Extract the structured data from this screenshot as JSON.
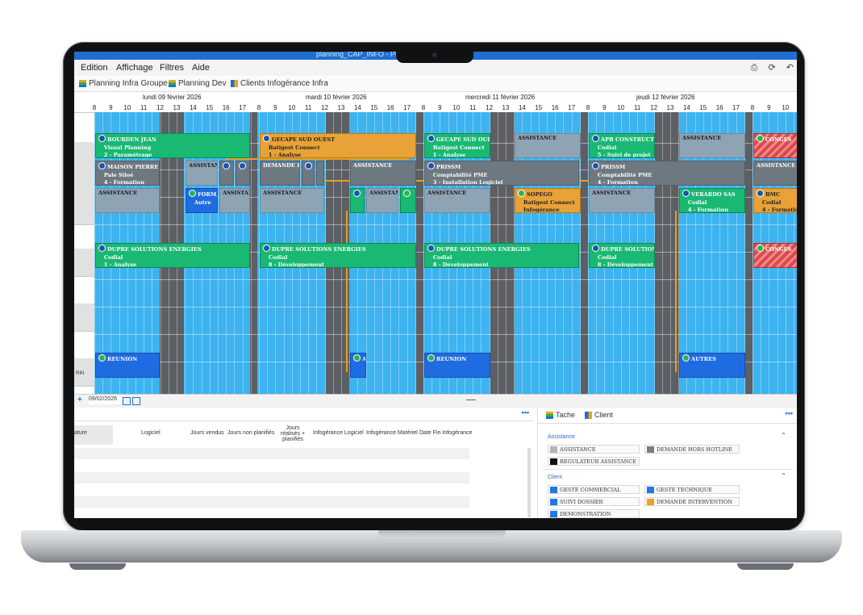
{
  "window": {
    "title": "planning_CAP_INFO - Plan"
  },
  "menu": {
    "items": [
      "Edition",
      "Affichage",
      "Filtres",
      "Aide"
    ]
  },
  "views": {
    "tabs": [
      "Planning Infra Groupe",
      "Planning Dev",
      "Clients Infogérance Infra"
    ]
  },
  "days": [
    {
      "label": "lundi 09 février 2026"
    },
    {
      "label": "mardi 10 février 2026"
    },
    {
      "label": "mercredi 11 février 2026"
    },
    {
      "label": "jeudi 12 février 2026"
    }
  ],
  "hours": [
    "8",
    "9",
    "10",
    "11",
    "12",
    "13",
    "14",
    "15",
    "16",
    "17"
  ],
  "resource_label_partial": "RIN",
  "events": {
    "e1": {
      "title": "BOURDEN JEAN",
      "l2": "Visual Planning",
      "l3": "2 - Paramétrage"
    },
    "e2": {
      "title": "GECAPE SUD OUEST",
      "l2": "Batigest Connect",
      "l3": "1 - Analyse"
    },
    "e3": {
      "title": "GECAPE SUD OUEST",
      "l2": "Batigest Connect",
      "l3": "1 - Analyse"
    },
    "e4": {
      "title": "ASSISTANCE"
    },
    "e5": {
      "title": "APB CONSTRUCTION",
      "l2": "Codial",
      "l3": "5 - Suivi de projet"
    },
    "e6": {
      "title": "ASSISTANCE"
    },
    "e7": {
      "title": "CONGÉS"
    },
    "e8": {
      "title": "MAISON PIERRE O",
      "l2": "Pale Siloé",
      "l3": "4 - Formation"
    },
    "e9": {
      "title": "ASSISTANCE"
    },
    "e10": {
      "title": "DEMANDE HO"
    },
    "e11": {
      "title": "ASSISTANCE"
    },
    "e12": {
      "title": "PRISSM",
      "l2": "Comptabilité PME",
      "l3": "3 - Installation Logiciel"
    },
    "e13": {
      "title": "PRISSM",
      "l2": "Comptabilité PME",
      "l3": "4 - Formation"
    },
    "e14": {
      "title": "ASSISTANCE"
    },
    "e15": {
      "title": "ASSISTANCE"
    },
    "e16": {
      "title": "FORMA",
      "l2": "Autre"
    },
    "e17": {
      "title": "ASSISTAN"
    },
    "e18": {
      "title": "ASSISTANCE"
    },
    "e19": {
      "title": "ASSISTANI"
    },
    "e20": {
      "title": "ASSISTANCE"
    },
    "e21": {
      "title": "SOPEGO",
      "l2": "Batigest Connect",
      "l3": "Infogérance"
    },
    "e22": {
      "title": "ASSISTANCE"
    },
    "e23": {
      "title": "VERARDO SAS",
      "l2": "Codial",
      "l3": "4 - Formation"
    },
    "e24": {
      "title": "BMC",
      "l2": "Codial",
      "l3": "4 - Formation"
    },
    "e25": {
      "title": "DUPRE SOLUTIONS ENERGIES",
      "l2": "Codial",
      "l3": "1 - Analyse"
    },
    "e26": {
      "title": "DUPRE SOLUTIONS ENERGIES",
      "l2": "Codial",
      "l3": "8 - Développement"
    },
    "e27": {
      "title": "DUPRE SOLUTIONS ENERGIES",
      "l2": "Codial",
      "l3": "8 - Développement"
    },
    "e28": {
      "title": "DUPRE SOLUTIONS",
      "l2": "Codial",
      "l3": "8 - Développement"
    },
    "e29": {
      "title": "CONGÉS"
    },
    "e30": {
      "title": "REUNION"
    },
    "e31": {
      "title": "REUNION"
    },
    "e32": {
      "title": "AUTRES"
    },
    "e33": {
      "title": "A"
    }
  },
  "footer": {
    "date_value": "09/02/2026"
  },
  "table": {
    "columns": [
      "ature",
      "Logiciel",
      "Jours vendus",
      "Jours non planifiés",
      "Jours réalisés + planifiés",
      "Infogérance Logiciel",
      "Infogérance Matériel",
      "Date Fin Infogérance"
    ]
  },
  "legend_panel": {
    "tabs": [
      "Tache",
      "Client"
    ],
    "sections": [
      {
        "title": "Assistance",
        "items": [
          {
            "label": "ASSISTANCE",
            "color": "#b5b5b5"
          },
          {
            "label": "DEMANDE HORS HOTLINE",
            "color": "#7d7d7d"
          },
          {
            "label": "REGULATEUR ASSISTANCE",
            "color": "#111111"
          }
        ]
      },
      {
        "title": "Client",
        "items": [
          {
            "label": "GESTE COMMERCIAL",
            "color": "#1e78e6"
          },
          {
            "label": "GESTE TECHNIQUE",
            "color": "#1e78e6"
          },
          {
            "label": "SUIVI DOSSIER",
            "color": "#1e78e6"
          },
          {
            "label": "DEMANDE INTERVENTION",
            "color": "#f0a020"
          },
          {
            "label": "DEMONSTRATION",
            "color": "#1e78e6"
          }
        ]
      }
    ]
  },
  "colors": {
    "grid": "#3db3f0",
    "lunch": "#5c5f63",
    "green": "#19b873",
    "orange": "#e9a237",
    "accent": "#1e6fd0"
  }
}
